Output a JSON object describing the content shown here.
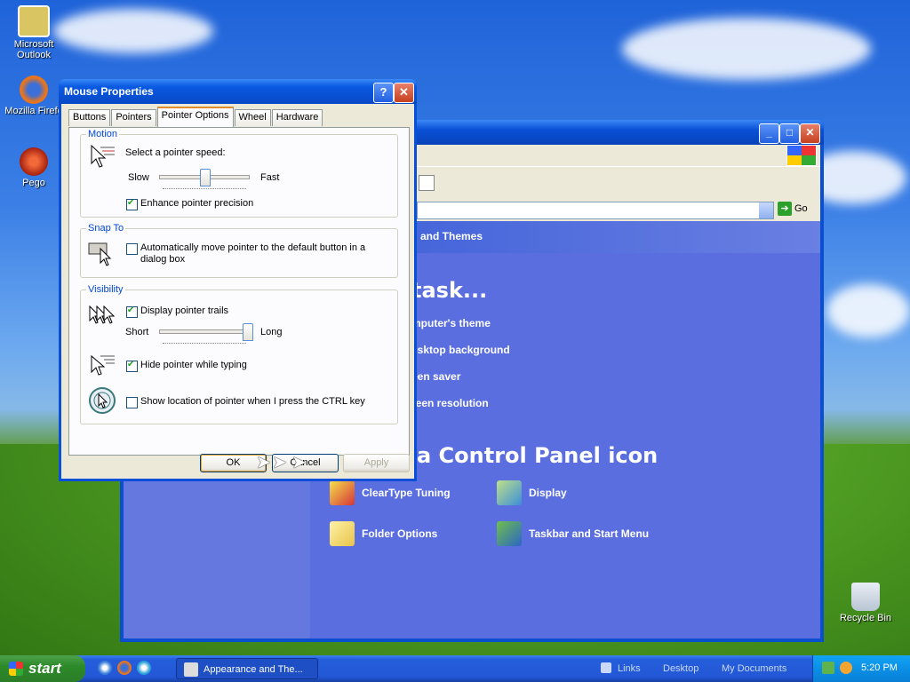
{
  "desktop": {
    "icons": [
      {
        "label": "Microsoft Outlook",
        "icon": "outlook-icon"
      },
      {
        "label": "Mozilla Firefo",
        "icon": "firefox-icon"
      },
      {
        "label": "Pego",
        "icon": "pego-icon"
      },
      {
        "label": "Recycle Bin",
        "icon": "recycle-bin-icon"
      }
    ]
  },
  "control_panel": {
    "address_go": "Go",
    "header": "and Themes",
    "pick_task": "task...",
    "tasks": [
      "mputer's theme",
      "esktop background",
      "een saver",
      "reen resolution"
    ],
    "pick_icon": "a Control Panel icon",
    "icons": [
      {
        "label": "ClearType Tuning"
      },
      {
        "label": "Display"
      },
      {
        "label": "Folder Options"
      },
      {
        "label": "Taskbar and Start Menu"
      }
    ]
  },
  "dialog": {
    "title": "Mouse Properties",
    "help": "?",
    "close": "✕",
    "tabs": [
      "Buttons",
      "Pointers",
      "Pointer Options",
      "Wheel",
      "Hardware"
    ],
    "active_tab": "Pointer Options",
    "motion": {
      "label": "Motion",
      "speed_label": "Select a pointer speed:",
      "slow": "Slow",
      "fast": "Fast",
      "speed_value": 0.5,
      "enhance_label": "Enhance pointer precision",
      "enhance_checked": true
    },
    "snap": {
      "label": "Snap To",
      "auto_label_1": "Automatically move pointer to the default button in a",
      "auto_label_2": "dialog box",
      "auto_checked": false
    },
    "visibility": {
      "label": "Visibility",
      "trails_label": "Display pointer trails",
      "trails_checked": true,
      "short": "Short",
      "long": "Long",
      "trails_value": 1.0,
      "hide_label": "Hide pointer while typing",
      "hide_checked": true,
      "show_label": "Show location of pointer when I press the CTRL key",
      "show_checked": false
    },
    "buttons": {
      "ok": "OK",
      "cancel": "Cancel",
      "apply": "Apply"
    }
  },
  "taskbar": {
    "start": "start",
    "task": "Appearance and The...",
    "links": "Links",
    "desktop": "Desktop",
    "my_documents": "My Documents",
    "clock": "5:20 PM"
  },
  "colors": {
    "xp_blue": "#0a4fd8",
    "dialog_face": "#ece9d8",
    "group_label": "#0046d5",
    "tray": "#0b8fe6",
    "start_green": "#2d8a2a"
  }
}
